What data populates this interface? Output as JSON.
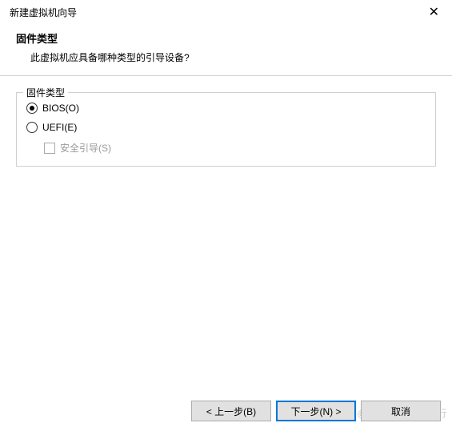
{
  "titlebar": {
    "title": "新建虚拟机向导"
  },
  "header": {
    "title": "固件类型",
    "subtitle": "此虚拟机应具备哪种类型的引导设备?"
  },
  "group": {
    "label": "固件类型",
    "options": {
      "bios": "BIOS(O)",
      "uefi": "UEFI(E)",
      "secure_boot": "安全引导(S)"
    }
  },
  "footer": {
    "back": "< 上一步(B)",
    "next": "下一步(N) >",
    "cancel": "取消"
  },
  "watermark": "CSDN @一个写代码的码行"
}
